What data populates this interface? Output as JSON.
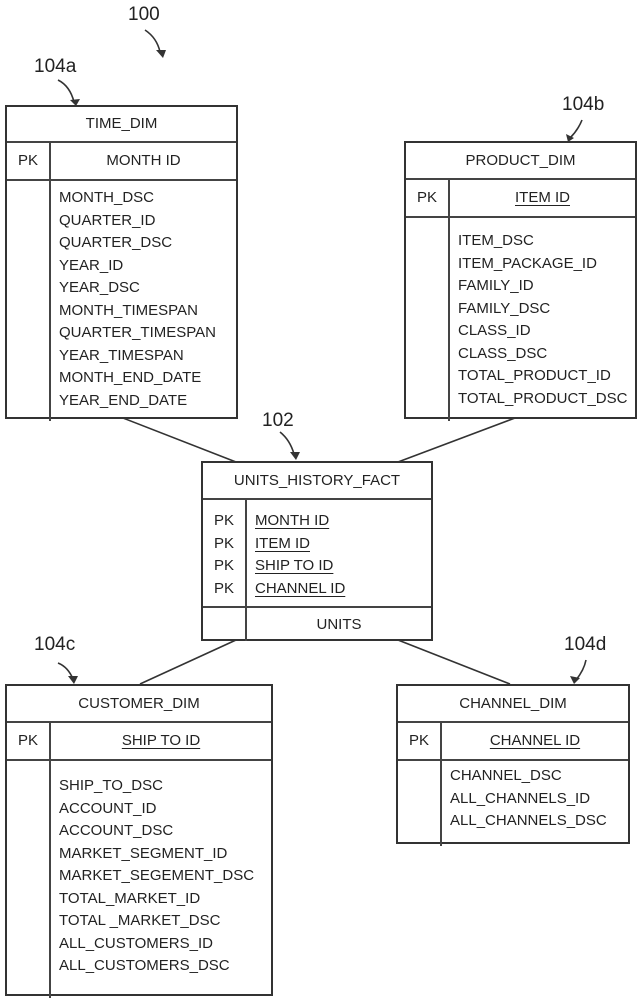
{
  "labels": {
    "diagram": "100",
    "fact": "102",
    "time": "104a",
    "product": "104b",
    "customer": "104c",
    "channel": "104d"
  },
  "pk_label": "PK",
  "time_dim": {
    "title": "TIME_DIM",
    "pk": "MONTH ID",
    "fields": [
      "MONTH_DSC",
      "QUARTER_ID",
      "QUARTER_DSC",
      "YEAR_ID",
      "YEAR_DSC",
      "MONTH_TIMESPAN",
      "QUARTER_TIMESPAN",
      "YEAR_TIMESPAN",
      "MONTH_END_DATE",
      "YEAR_END_DATE"
    ]
  },
  "product_dim": {
    "title": "PRODUCT_DIM",
    "pk": "ITEM ID",
    "fields": [
      "ITEM_DSC",
      "ITEM_PACKAGE_ID",
      "FAMILY_ID",
      "FAMILY_DSC",
      "CLASS_ID",
      "CLASS_DSC",
      "TOTAL_PRODUCT_ID",
      "TOTAL_PRODUCT_DSC"
    ]
  },
  "fact": {
    "title": "UNITS_HISTORY_FACT",
    "pks": [
      "MONTH ID",
      "ITEM ID",
      "SHIP TO ID",
      "CHANNEL ID"
    ],
    "measure": "UNITS"
  },
  "customer_dim": {
    "title": "CUSTOMER_DIM",
    "pk": "SHIP TO ID",
    "fields": [
      "SHIP_TO_DSC",
      "ACCOUNT_ID",
      "ACCOUNT_DSC",
      "MARKET_SEGMENT_ID",
      "MARKET_SEGEMENT_DSC",
      "TOTAL_MARKET_ID",
      "TOTAL _MARKET_DSC",
      "ALL_CUSTOMERS_ID",
      "ALL_CUSTOMERS_DSC"
    ]
  },
  "channel_dim": {
    "title": "CHANNEL_DIM",
    "pk": "CHANNEL ID",
    "fields": [
      "CHANNEL_DSC",
      "ALL_CHANNELS_ID",
      "ALL_CHANNELS_DSC"
    ]
  }
}
